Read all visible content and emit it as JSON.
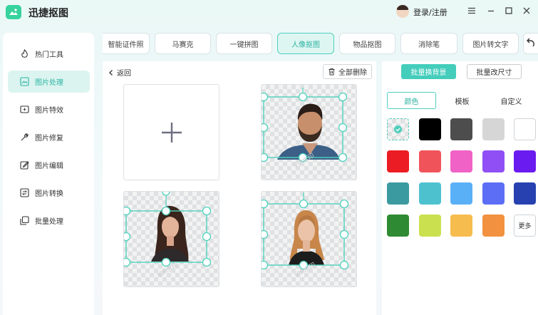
{
  "app": {
    "title": "迅捷抠图",
    "login_label": "登录/注册"
  },
  "tabs": [
    {
      "label": "智能证件照",
      "active": false
    },
    {
      "label": "马赛克",
      "active": false
    },
    {
      "label": "一键拼图",
      "active": false
    },
    {
      "label": "人像抠图",
      "active": true
    },
    {
      "label": "物品抠图",
      "active": false
    },
    {
      "label": "消除笔",
      "active": false
    },
    {
      "label": "图片转文字",
      "active": false
    }
  ],
  "sidebar": {
    "items": [
      {
        "label": "热门工具",
        "icon": "fire-icon"
      },
      {
        "label": "图片处理",
        "icon": "image-process-icon",
        "active": true
      },
      {
        "label": "图片特效",
        "icon": "sparkle-icon"
      },
      {
        "label": "图片修复",
        "icon": "wrench-icon"
      },
      {
        "label": "图片编辑",
        "icon": "edit-icon"
      },
      {
        "label": "图片转换",
        "icon": "convert-icon"
      },
      {
        "label": "批量处理",
        "icon": "batch-icon"
      }
    ]
  },
  "main": {
    "back_label": "返回",
    "delete_all_label": "全部删除",
    "watermark": "VIP水印"
  },
  "right_panel": {
    "tabs": [
      {
        "label": "批量换背景",
        "active": true
      },
      {
        "label": "批量改尺寸",
        "active": false
      }
    ],
    "sub_tabs": [
      {
        "label": "颜色",
        "active": true
      },
      {
        "label": "模板",
        "active": false
      },
      {
        "label": "自定义",
        "active": false
      }
    ],
    "more_label": "更多",
    "colors": [
      "transparent",
      "#000000",
      "#4d4d4d",
      "#d6d6d6",
      "#ffffff",
      "#ec1c24",
      "#f0545a",
      "#f062c6",
      "#8f4ff5",
      "#6a1bf0",
      "#3b9aa0",
      "#4ec1cf",
      "#5ab0f7",
      "#5c6ef5",
      "#2742b0",
      "#2f8a34",
      "#cbe04f",
      "#f7bc4e",
      "#f29240"
    ],
    "selected_color": "transparent"
  },
  "colors": {
    "accent": "#44cdbb",
    "accent_dark": "#2bb3a1"
  }
}
